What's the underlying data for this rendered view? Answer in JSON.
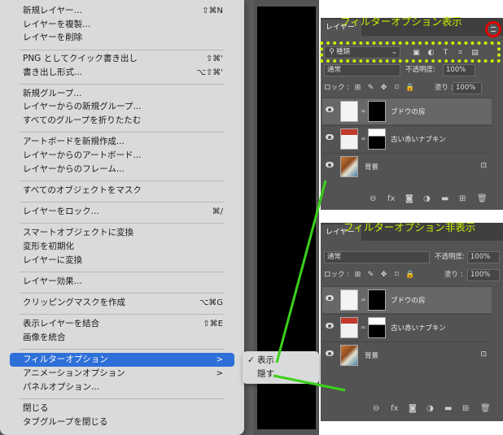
{
  "menu": {
    "items": [
      {
        "label": "新規レイヤー...",
        "shortcut": "⇧⌘N"
      },
      {
        "label": "レイヤーを複製...",
        "shortcut": ""
      },
      {
        "label": "レイヤーを削除",
        "shortcut": ""
      },
      {
        "label": "PNG としてクイック書き出し",
        "shortcut": "⇧⌘'"
      },
      {
        "label": "書き出し形式...",
        "shortcut": "⌥⇧⌘'"
      },
      {
        "label": "新規グループ...",
        "shortcut": ""
      },
      {
        "label": "レイヤーからの新規グループ...",
        "shortcut": ""
      },
      {
        "label": "すべてのグループを折りたたむ",
        "shortcut": ""
      },
      {
        "label": "アートボードを新規作成...",
        "shortcut": ""
      },
      {
        "label": "レイヤーからのアートボード...",
        "shortcut": ""
      },
      {
        "label": "レイヤーからのフレーム...",
        "shortcut": ""
      },
      {
        "label": "すべてのオブジェクトをマスク",
        "shortcut": ""
      },
      {
        "label": "レイヤーをロック...",
        "shortcut": "⌘/"
      },
      {
        "label": "スマートオブジェクトに変換",
        "shortcut": ""
      },
      {
        "label": "変形を初期化",
        "shortcut": ""
      },
      {
        "label": "レイヤーに変換",
        "shortcut": ""
      },
      {
        "label": "レイヤー効果...",
        "shortcut": ""
      },
      {
        "label": "クリッピングマスクを作成",
        "shortcut": "⌥⌘G"
      },
      {
        "label": "表示レイヤーを結合",
        "shortcut": "⇧⌘E"
      },
      {
        "label": "画像を統合",
        "shortcut": ""
      },
      {
        "label": "フィルターオプション",
        "shortcut": ">"
      },
      {
        "label": "アニメーションオプション",
        "shortcut": ">"
      },
      {
        "label": "パネルオプション...",
        "shortcut": ""
      },
      {
        "label": "閉じる",
        "shortcut": ""
      },
      {
        "label": "タブグループを閉じる",
        "shortcut": ""
      }
    ]
  },
  "submenu": {
    "check": "✓",
    "show": "表示",
    "hide": "隠す"
  },
  "panel_top": {
    "annotation": "フィルターオプション表示",
    "tab": "レイヤー",
    "filter_kind": "種類",
    "blend": "通常",
    "opacity_label": "不透明度:",
    "opacity": "100%",
    "lock_label": "ロック :",
    "fill_label": "塗り :",
    "fill": "100%",
    "layers": [
      {
        "name": "ブドウの房"
      },
      {
        "name": "古い赤いナプキン"
      },
      {
        "name": "背景"
      }
    ]
  },
  "panel_bottom": {
    "annotation": "フィルターオプション非表示",
    "tab": "レイヤー",
    "blend": "通常",
    "opacity_label": "不透明度:",
    "opacity": "100%",
    "lock_label": "ロック :",
    "fill_label": "塗り :",
    "fill": "100%",
    "layers": [
      {
        "name": "ブドウの房"
      },
      {
        "name": "古い赤いナプキン"
      },
      {
        "name": "背景"
      }
    ]
  },
  "colors": {
    "highlight": "#2e6fd8",
    "annotation": "#c8f000",
    "arrow": "#3ad11a",
    "circle": "#e00000"
  }
}
